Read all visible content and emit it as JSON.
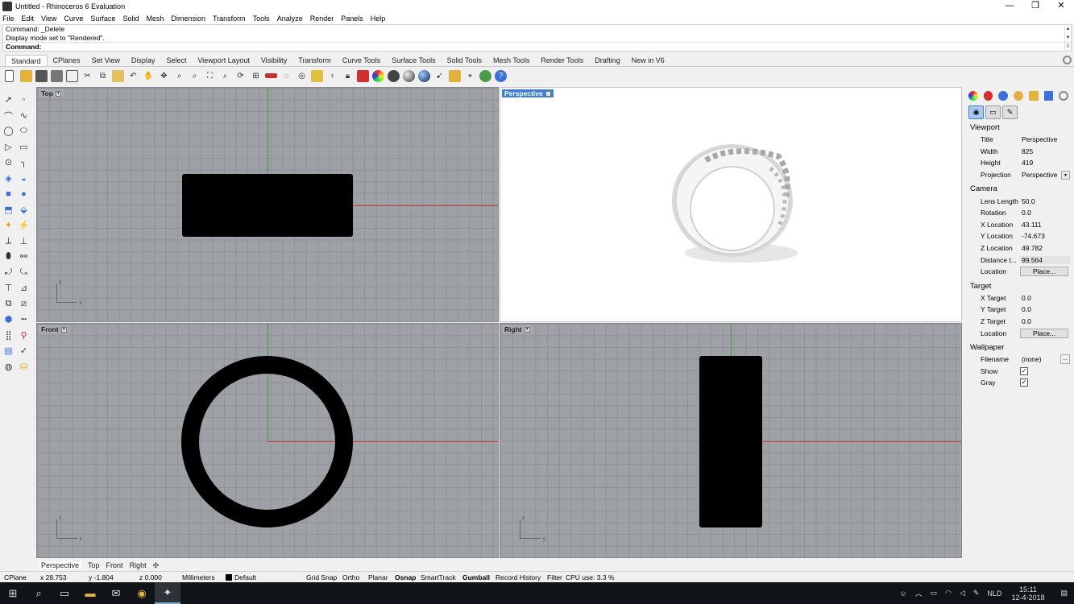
{
  "window": {
    "title": "Untitled - Rhinoceros 6 Evaluation",
    "minimize": "—",
    "maximize": "❐",
    "close": "✕"
  },
  "menu": [
    "File",
    "Edit",
    "View",
    "Curve",
    "Surface",
    "Solid",
    "Mesh",
    "Dimension",
    "Transform",
    "Tools",
    "Analyze",
    "Render",
    "Panels",
    "Help"
  ],
  "command": {
    "history": [
      "Command: _Delete",
      "Display mode set to \"Rendered\"."
    ],
    "prompt": "Command:"
  },
  "tabs": [
    "Standard",
    "CPlanes",
    "Set View",
    "Display",
    "Select",
    "Viewport Layout",
    "Visibility",
    "Transform",
    "Curve Tools",
    "Surface Tools",
    "Solid Tools",
    "Mesh Tools",
    "Render Tools",
    "Drafting",
    "New in V6"
  ],
  "toolbar_icons": [
    "new-file-icon",
    "open-icon",
    "save-icon",
    "print-icon",
    "import-icon",
    "cut-icon",
    "copy-icon",
    "paste-icon",
    "undo-icon",
    "pan-icon",
    "move-view-icon",
    "zoom-icon",
    "zoom-window-icon",
    "zoom-extents-icon",
    "zoom-selected-icon",
    "rotate-view-icon",
    "four-view-icon",
    "cplane-icon",
    "hide-icon",
    "show-icon",
    "lock-icon",
    "light-icon",
    "lock2-icon",
    "material-icon",
    "color-icon",
    "rendered-icon",
    "shaded-icon",
    "sphere-icon",
    "select-icon",
    "options-icon",
    "snap-icon",
    "globe-icon",
    "help-icon"
  ],
  "viewports": {
    "top": {
      "label": "Top",
      "axis_a": "y",
      "axis_b": "x"
    },
    "perspective": {
      "label": "Perspective"
    },
    "front": {
      "label": "Front",
      "axis_a": "z",
      "axis_b": "x"
    },
    "right": {
      "label": "Right",
      "axis_a": "z",
      "axis_b": "y"
    }
  },
  "viewport_tabs": [
    "Perspective",
    "Top",
    "Front",
    "Right"
  ],
  "viewport_tab_add": "✣",
  "properties": {
    "viewport": {
      "title": "Viewport",
      "rows": [
        {
          "k": "Title",
          "v": "Perspective"
        },
        {
          "k": "Width",
          "v": "825"
        },
        {
          "k": "Height",
          "v": "419"
        },
        {
          "k": "Projection",
          "v": "Perspective"
        }
      ]
    },
    "camera": {
      "title": "Camera",
      "rows": [
        {
          "k": "Lens Length",
          "v": "50.0"
        },
        {
          "k": "Rotation",
          "v": "0.0"
        },
        {
          "k": "X Location",
          "v": "43.111"
        },
        {
          "k": "Y Location",
          "v": "-74.673"
        },
        {
          "k": "Z Location",
          "v": "49.782"
        },
        {
          "k": "Distance t...",
          "v": "99.564"
        },
        {
          "k": "Location",
          "v": "Place..."
        }
      ]
    },
    "target": {
      "title": "Target",
      "rows": [
        {
          "k": "X Target",
          "v": "0.0"
        },
        {
          "k": "Y Target",
          "v": "0.0"
        },
        {
          "k": "Z Target",
          "v": "0.0"
        },
        {
          "k": "Location",
          "v": "Place..."
        }
      ]
    },
    "wallpaper": {
      "title": "Wallpaper",
      "rows": [
        {
          "k": "Filename",
          "v": "(none)"
        },
        {
          "k": "Show",
          "v": "✓"
        },
        {
          "k": "Gray",
          "v": "✓"
        }
      ]
    },
    "filename_button": "..."
  },
  "status": {
    "cplane": "CPlane",
    "x": "x 28.753",
    "y": "y -1.804",
    "z": "z 0.000",
    "units": "Millimeters",
    "layer": "Default",
    "items": [
      "Grid Snap",
      "Ortho",
      "Planar",
      "Osnap",
      "SmartTrack",
      "Gumball",
      "Record History",
      "Filter"
    ],
    "bold": [
      "Osnap",
      "Gumball"
    ],
    "cpu": "CPU use: 3.3 %"
  },
  "taskbar": {
    "lang": "NLD",
    "time": "15:11",
    "date": "12-4-2018"
  }
}
